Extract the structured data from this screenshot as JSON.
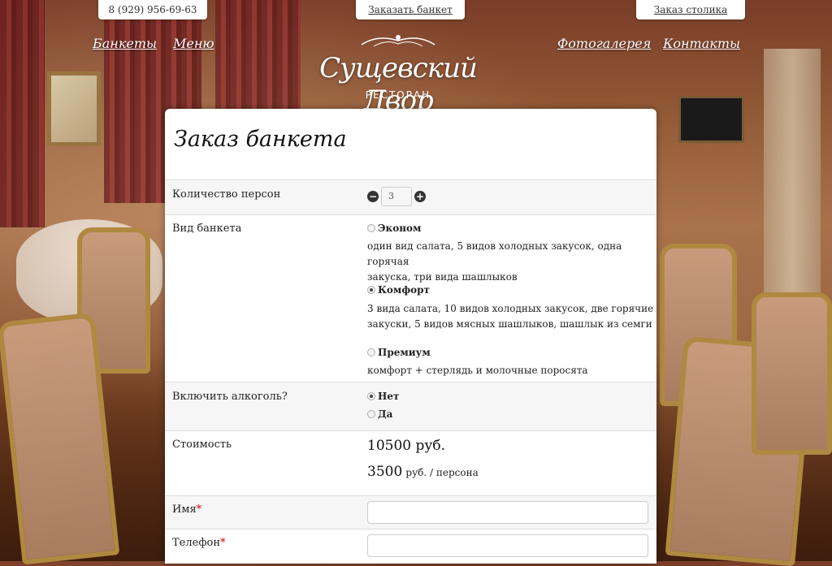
{
  "topbar": {
    "phone": "8 (929) 956-69-63",
    "banquet_order": "Заказать банкет",
    "table_order": "Заказ столика"
  },
  "nav": {
    "banquets": "Банкеты",
    "menu": "Меню",
    "gallery": "Фотогалерея",
    "contacts": "Контакты"
  },
  "logo": {
    "name": "Сущевский Двор",
    "subtitle": "РЕСТОРАН"
  },
  "form": {
    "title": "Заказ банкета",
    "persons": {
      "label": "Количество персон",
      "value": "3",
      "minus": "−",
      "plus": "+"
    },
    "type": {
      "label": "Вид банкета",
      "options": [
        {
          "title": "Эконом",
          "desc1": "один вид салата, 5 видов холодных закусок, одна горячая",
          "desc2": "закуска, три вида шашлыков",
          "selected": false
        },
        {
          "title": "Комфорт",
          "desc1": "3 вида салата, 10 видов холодных закусок, две горячие",
          "desc2": "закуски, 5 видов мясных шашлыков, шашлык из семги",
          "selected": true
        },
        {
          "title": "Премиум",
          "desc1": "комфорт + стерлядь и молочные поросята",
          "selected": false
        }
      ]
    },
    "alcohol": {
      "label": "Включить алкоголь?",
      "options": [
        {
          "title": "Нет",
          "selected": true
        },
        {
          "title": "Да",
          "selected": false
        }
      ]
    },
    "cost": {
      "label": "Стоимость",
      "total": "10500 руб.",
      "per_person_value": "3500",
      "per_person_unit": "руб. / персона"
    },
    "name": {
      "label": "Имя",
      "required_mark": "*",
      "value": ""
    },
    "phone": {
      "label": "Телефон",
      "required_mark": "*",
      "value": ""
    }
  }
}
